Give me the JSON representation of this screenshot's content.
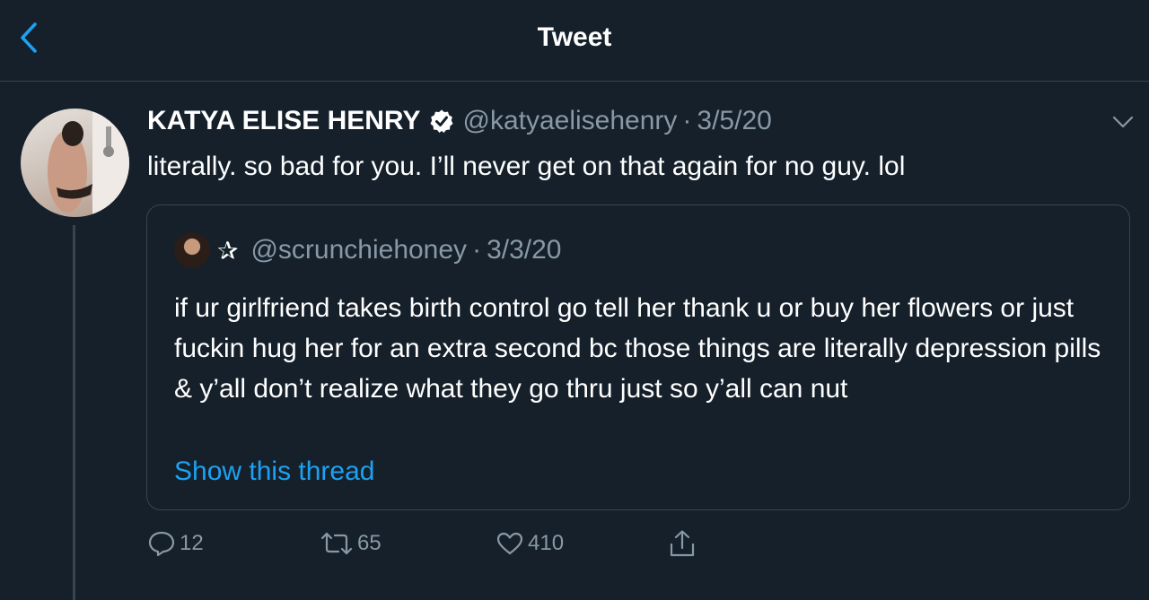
{
  "header": {
    "title": "Tweet",
    "back_icon": "chevron-left-icon"
  },
  "tweet": {
    "author_name": "KATYA ELISE HENRY",
    "verified_icon": "verified-badge-icon",
    "handle": "@katyaelisehenry",
    "separator": "·",
    "date": "3/5/20",
    "text": "literally. so bad for you. I’ll never get on that again for no guy. lol",
    "menu_icon": "chevron-down-icon"
  },
  "quote": {
    "star": "✰",
    "handle": "@scrunchiehoney",
    "separator": "·",
    "date": "3/3/20",
    "text": "if ur girlfriend takes birth control go tell her thank u or buy her flowers or just fuckin hug her for an extra second bc those things are literally depression pills & y’all don’t realize what they go thru just so y’all can nut",
    "show_thread": "Show this thread"
  },
  "actions": {
    "reply_count": "12",
    "retweet_count": "65",
    "like_count": "410",
    "share_icon": "share-icon"
  },
  "colors": {
    "background": "#15202b",
    "border": "#38444d",
    "secondary_text": "#8899a6",
    "accent": "#1da1f2"
  }
}
